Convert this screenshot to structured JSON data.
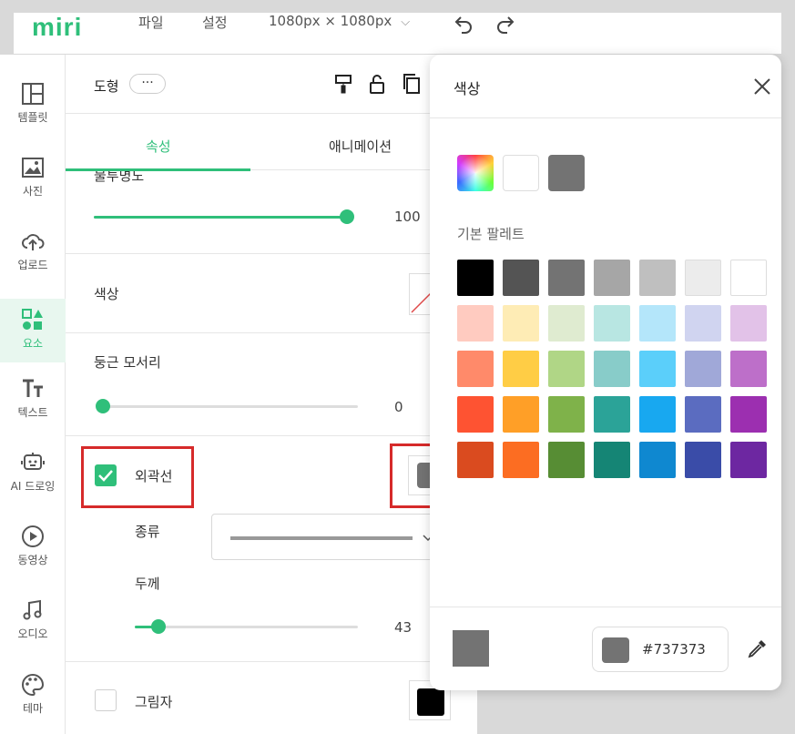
{
  "topbar": {
    "logo": "miri",
    "menu_file": "파일",
    "menu_settings": "설정",
    "canvas_size": "1080px × 1080px"
  },
  "sidebar": {
    "items": [
      {
        "label": "템플릿",
        "icon": "template-icon"
      },
      {
        "label": "사진",
        "icon": "photo-icon"
      },
      {
        "label": "업로드",
        "icon": "upload-icon"
      },
      {
        "label": "요소",
        "icon": "elements-icon"
      },
      {
        "label": "텍스트",
        "icon": "text-icon"
      },
      {
        "label": "AI 드로잉",
        "icon": "ai-drawing-icon"
      },
      {
        "label": "동영상",
        "icon": "video-icon"
      },
      {
        "label": "오디오",
        "icon": "audio-icon"
      },
      {
        "label": "테마",
        "icon": "theme-icon"
      }
    ],
    "active": "요소"
  },
  "panel": {
    "title": "도형",
    "more_label": "···",
    "tabs": [
      "속성",
      "애니메이션"
    ],
    "active_tab": "속성",
    "opacity": {
      "label": "불투명도",
      "value": "100",
      "level": 1.0
    },
    "color": {
      "label": "색상"
    },
    "corner": {
      "label": "둥근 모서리",
      "value": "0",
      "level": 0.0
    },
    "stroke": {
      "label": "외곽선",
      "checked": true,
      "color": "#737373",
      "type_label": "종류",
      "width_label": "두께",
      "width_value": "43",
      "width_level": 0.1
    },
    "shadow": {
      "label": "그림자",
      "checked": false,
      "color": "#000000"
    }
  },
  "picker": {
    "title": "색상",
    "recent_colors": [
      "rainbow",
      "#ffffff",
      "#737373"
    ],
    "palette_label": "기본 팔레트",
    "palette": [
      [
        "#000000",
        "#545454",
        "#737373",
        "#a6a6a6",
        "#bfbfbf",
        "#ececec",
        "#ffffff"
      ],
      [
        "#ffcbc0",
        "#feecb5",
        "#dfebd0",
        "#b8e6e2",
        "#b4e6fa",
        "#d0d4f0",
        "#e2c2e8"
      ],
      [
        "#ff8a6a",
        "#ffcd45",
        "#b0d686",
        "#88ccc9",
        "#5bcffa",
        "#a0a8d8",
        "#bd6fc9"
      ],
      [
        "#fe5332",
        "#ff9f27",
        "#7fb24a",
        "#2ba398",
        "#18a8f0",
        "#5b6cc0",
        "#9c2fb0"
      ],
      [
        "#da4b1f",
        "#fc6d22",
        "#578d34",
        "#158575",
        "#0f88d0",
        "#3a4ca8",
        "#6d27a1"
      ]
    ],
    "current_color": "#737373",
    "hex_value": "#737373"
  },
  "colors": {
    "accent": "#2fbf7a",
    "highlight_box": "#d62a2a"
  }
}
